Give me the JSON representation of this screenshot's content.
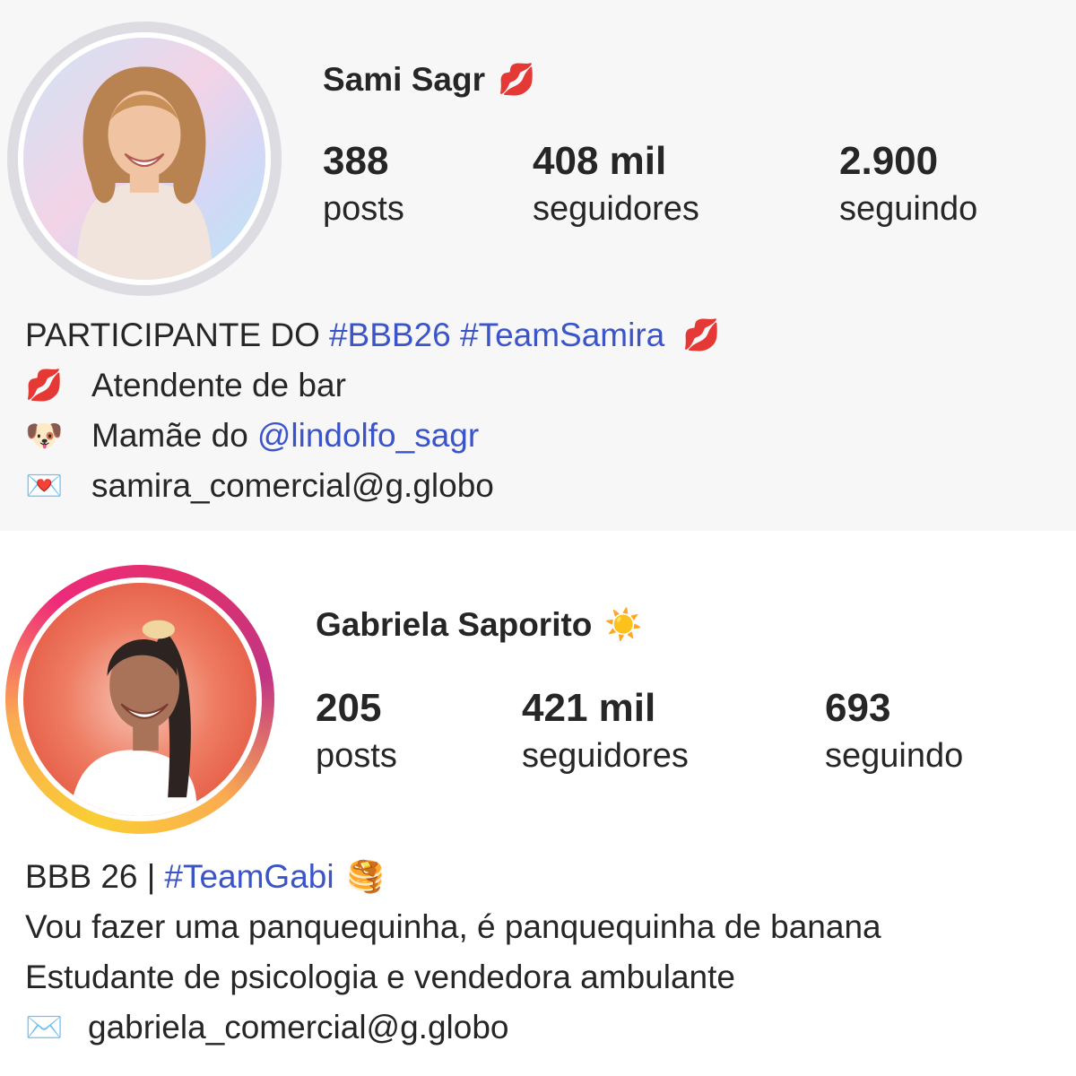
{
  "profiles": [
    {
      "name": "Sami Sagr",
      "name_emoji": "💋",
      "stats": [
        {
          "value": "388",
          "label": "posts"
        },
        {
          "value": "408 mil",
          "label": "seguidores"
        },
        {
          "value": "2.900",
          "label": "seguindo"
        }
      ],
      "bio": {
        "line1_prefix": "PARTICIPANTE DO ",
        "line1_tags": "#BBB26 #TeamSamira",
        "line1_emoji": "💋",
        "line2_emoji": "💋",
        "line2_text": "Atendente de bar",
        "line3_emoji": "🐶",
        "line3_prefix": "Mamãe do ",
        "line3_mention": "@lindolfo_sagr",
        "line4_emoji": "💌",
        "line4_text": "samira_comercial@g.globo"
      }
    },
    {
      "name": "Gabriela Saporito",
      "name_emoji": "☀️",
      "stats": [
        {
          "value": "205",
          "label": "posts"
        },
        {
          "value": "421 mil",
          "label": "seguidores"
        },
        {
          "value": "693",
          "label": "seguindo"
        }
      ],
      "bio": {
        "line1_prefix": "BBB 26 | ",
        "line1_tag": "#TeamGabi",
        "line1_emoji": "🥞",
        "line2_text": "Vou fazer uma panquequinha, é panquequinha de banana",
        "line3_text": "Estudante de psicologia e vendedora ambulante",
        "line4_emoji": "✉️",
        "line4_text": "gabriela_comercial@g.globo"
      }
    }
  ],
  "colors": {
    "link": "#3b55c9",
    "text": "#262626",
    "story_ring_seen": "#dcdce2"
  },
  "icons": [
    "link-icon"
  ]
}
